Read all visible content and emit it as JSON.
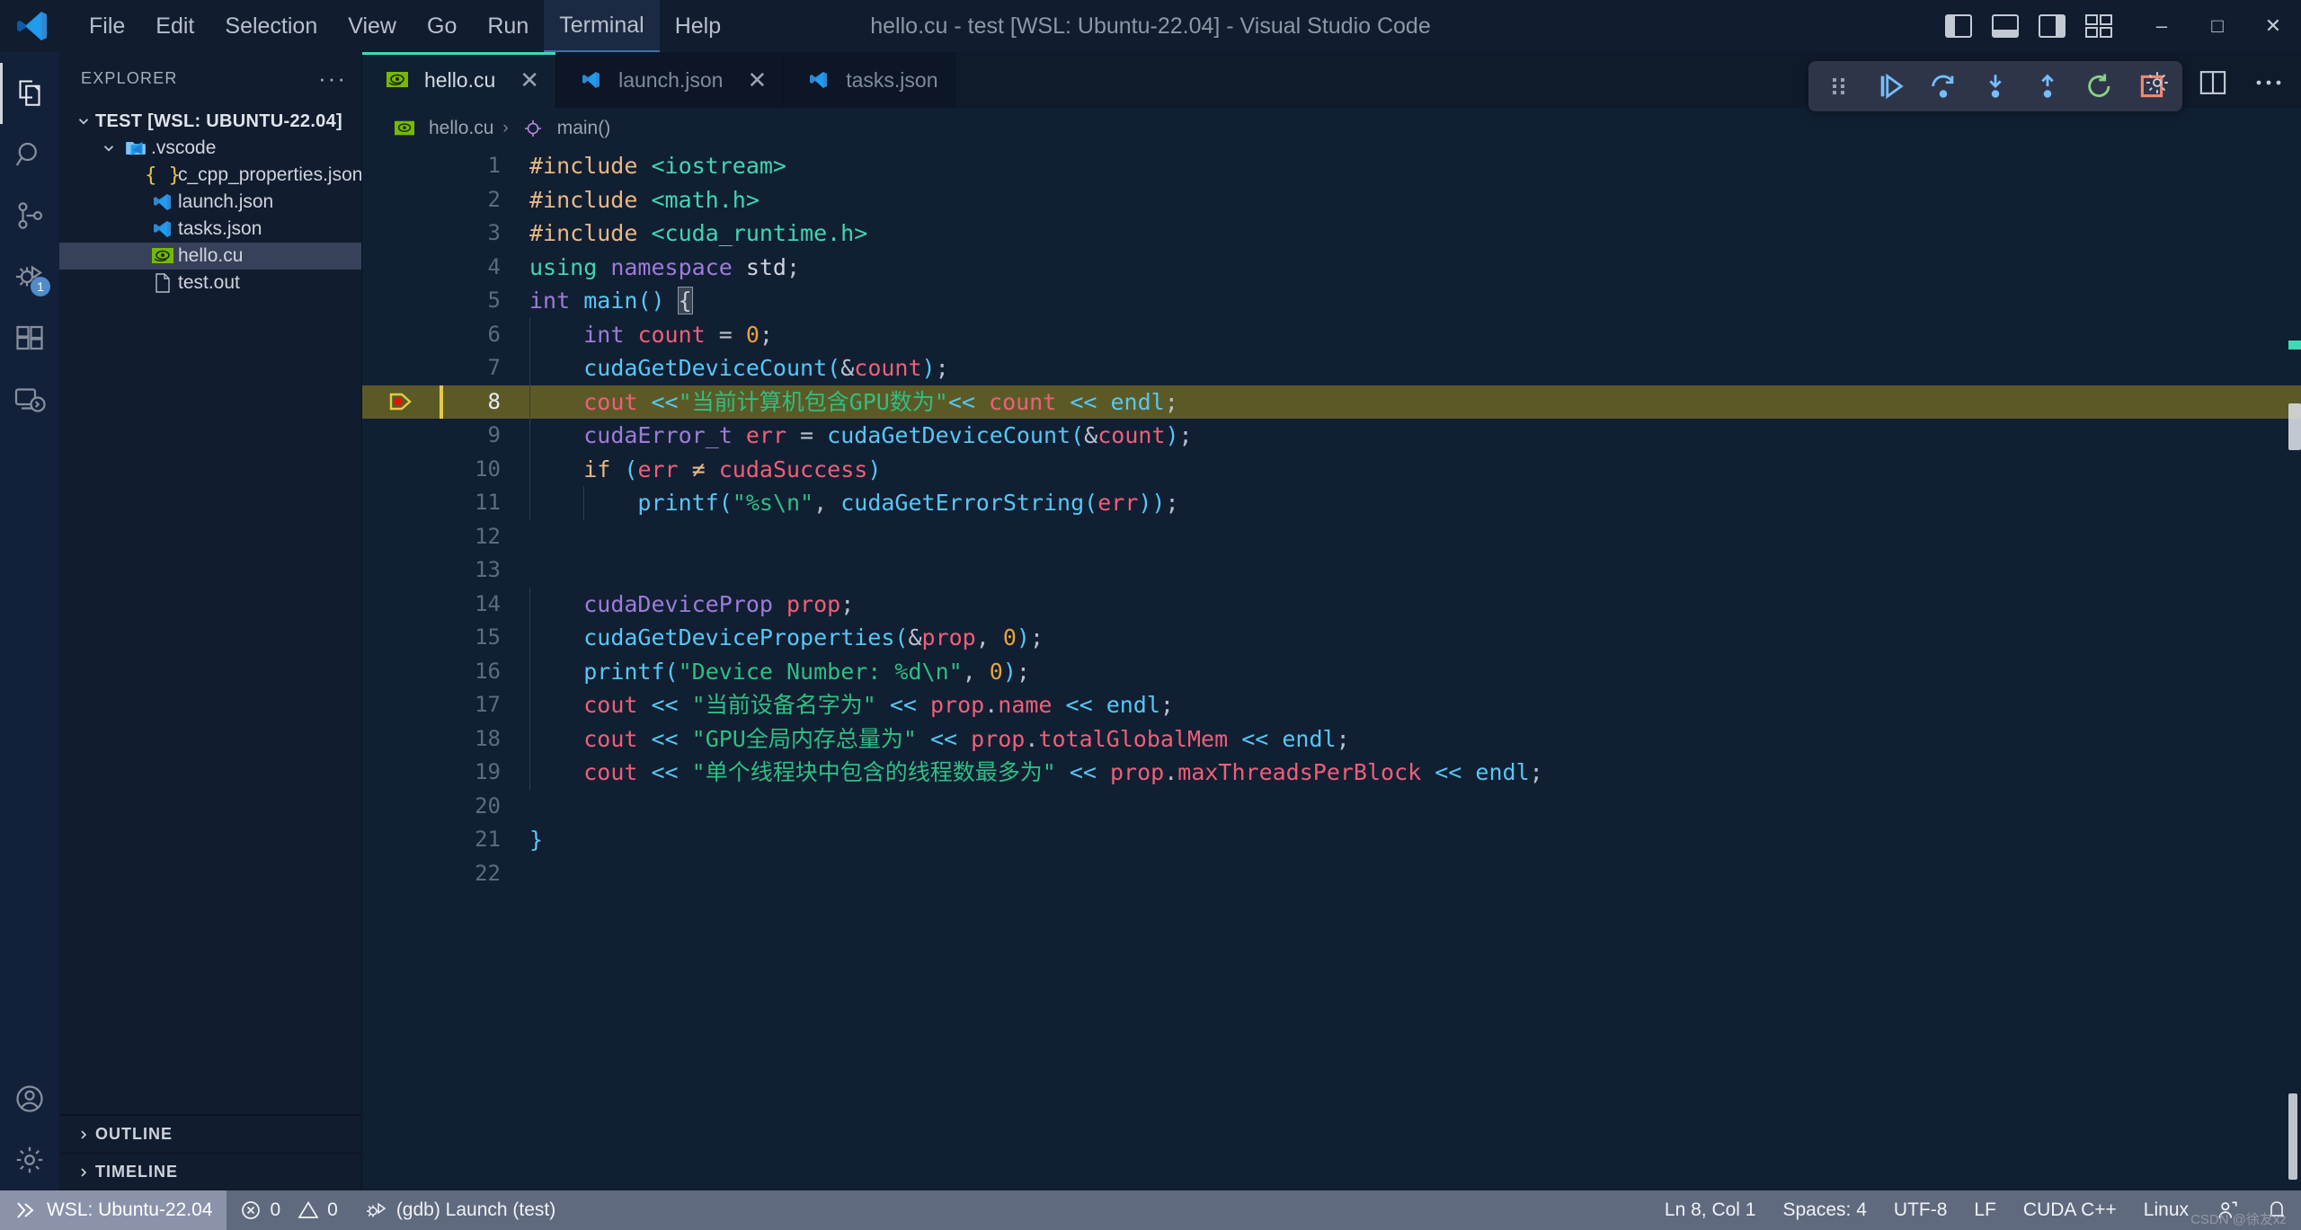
{
  "window": {
    "title": "hello.cu - test [WSL: Ubuntu-22.04] - Visual Studio Code",
    "minimize_label": "–",
    "maximize_label": "□",
    "close_label": "✕"
  },
  "menu": {
    "items": [
      {
        "label": "File"
      },
      {
        "label": "Edit"
      },
      {
        "label": "Selection"
      },
      {
        "label": "View"
      },
      {
        "label": "Go"
      },
      {
        "label": "Run"
      },
      {
        "label": "Terminal"
      },
      {
        "label": "Help"
      }
    ]
  },
  "activitybar": {
    "items": [
      {
        "name": "explorer",
        "icon": "files-icon",
        "active": true,
        "badge": ""
      },
      {
        "name": "search",
        "icon": "search-icon",
        "active": false,
        "badge": ""
      },
      {
        "name": "source-control",
        "icon": "source-control-icon",
        "active": false,
        "badge": ""
      },
      {
        "name": "run-and-debug",
        "icon": "debug-icon",
        "active": false,
        "badge": "1"
      },
      {
        "name": "extensions",
        "icon": "extensions-icon",
        "active": false,
        "badge": ""
      },
      {
        "name": "remote-explorer",
        "icon": "remote-explorer-icon",
        "active": false,
        "badge": ""
      }
    ],
    "bottom": [
      {
        "name": "accounts",
        "icon": "account-icon"
      },
      {
        "name": "manage",
        "icon": "gear-icon"
      }
    ]
  },
  "sidebar": {
    "header": "EXPLORER",
    "more_actions": "···",
    "root": {
      "label": "TEST [WSL: UBUNTU-22.04]",
      "expanded": true
    },
    "tree": [
      {
        "label": ".vscode",
        "icon": "vscode-folder-icon",
        "depth": 1,
        "expanded": true,
        "selected": false
      },
      {
        "label": "c_cpp_properties.json",
        "icon": "json-braces-icon",
        "depth": 2,
        "selected": false
      },
      {
        "label": "launch.json",
        "icon": "vscode-file-icon",
        "depth": 2,
        "selected": false
      },
      {
        "label": "tasks.json",
        "icon": "vscode-file-icon",
        "depth": 2,
        "selected": false
      },
      {
        "label": "hello.cu",
        "icon": "nvidia-cuda-icon",
        "depth": 1,
        "selected": true
      },
      {
        "label": "test.out",
        "icon": "plain-file-icon",
        "depth": 1,
        "selected": false
      }
    ],
    "sections": [
      {
        "label": "OUTLINE"
      },
      {
        "label": "TIMELINE"
      }
    ]
  },
  "tabs": [
    {
      "label": "hello.cu",
      "icon": "nvidia-cuda-icon",
      "active": true,
      "close": "✕"
    },
    {
      "label": "launch.json",
      "icon": "vscode-file-icon",
      "active": false,
      "close": "✕"
    },
    {
      "label": "tasks.json",
      "icon": "vscode-file-icon",
      "active": false,
      "close": ""
    }
  ],
  "breadcrumb": {
    "file": "hello.cu",
    "separator": "›",
    "symbol": "main()",
    "symbol_icon": "method-icon"
  },
  "debug_toolbar": {
    "buttons": [
      {
        "name": "drag-handle",
        "icon": "grip-dots-icon"
      },
      {
        "name": "continue",
        "icon": "continue-icon"
      },
      {
        "name": "step-over",
        "icon": "step-over-icon"
      },
      {
        "name": "step-into",
        "icon": "step-into-icon"
      },
      {
        "name": "step-out",
        "icon": "step-out-icon"
      },
      {
        "name": "restart",
        "icon": "restart-icon"
      },
      {
        "name": "stop",
        "icon": "stop-icon"
      }
    ]
  },
  "editor_actions": [
    {
      "name": "settings",
      "icon": "gear-icon"
    },
    {
      "name": "split-editor",
      "icon": "split-editor-icon"
    },
    {
      "name": "more-actions",
      "icon": "ellipsis-icon"
    }
  ],
  "editor": {
    "current_line": 8,
    "breakpoint_line": 8,
    "total_lines": 22,
    "lines": [
      {
        "n": 1,
        "tokens": [
          {
            "t": "#include ",
            "c": "t-pre"
          },
          {
            "t": "<iostream>",
            "c": "t-inc"
          }
        ]
      },
      {
        "n": 2,
        "tokens": [
          {
            "t": "#include ",
            "c": "t-pre"
          },
          {
            "t": "<math.h>",
            "c": "t-inc"
          }
        ]
      },
      {
        "n": 3,
        "tokens": [
          {
            "t": "#include ",
            "c": "t-pre"
          },
          {
            "t": "<cuda_runtime.h>",
            "c": "t-inc"
          }
        ]
      },
      {
        "n": 4,
        "tokens": [
          {
            "t": "using ",
            "c": "t-kw"
          },
          {
            "t": "namespace ",
            "c": "t-kw2"
          },
          {
            "t": "std",
            "c": "t-id"
          },
          {
            "t": ";",
            "c": "t-pun"
          }
        ]
      },
      {
        "n": 5,
        "tokens": [
          {
            "t": "int ",
            "c": "t-type"
          },
          {
            "t": "main",
            "c": "t-fn"
          },
          {
            "t": "() ",
            "c": "t-brace"
          },
          {
            "t": "{",
            "c": "cursor-box"
          }
        ]
      },
      {
        "n": 6,
        "tokens": [
          {
            "t": "    ",
            "c": "t-pun"
          },
          {
            "t": "int ",
            "c": "t-type"
          },
          {
            "t": "count",
            "c": "t-var"
          },
          {
            "t": " = ",
            "c": "t-pun"
          },
          {
            "t": "0",
            "c": "t-num"
          },
          {
            "t": ";",
            "c": "t-pun"
          }
        ]
      },
      {
        "n": 7,
        "tokens": [
          {
            "t": "    ",
            "c": "t-pun"
          },
          {
            "t": "cudaGetDeviceCount",
            "c": "t-fn"
          },
          {
            "t": "(",
            "c": "t-brace"
          },
          {
            "t": "&",
            "c": "t-pun"
          },
          {
            "t": "count",
            "c": "t-var"
          },
          {
            "t": ")",
            "c": "t-brace"
          },
          {
            "t": ";",
            "c": "t-pun"
          }
        ]
      },
      {
        "n": 8,
        "tokens": [
          {
            "t": "    ",
            "c": "t-pun"
          },
          {
            "t": "cout",
            "c": "t-var"
          },
          {
            "t": " <<",
            "c": "t-op"
          },
          {
            "t": "\"当前计算机包含GPU数为\"",
            "c": "t-str"
          },
          {
            "t": "<< ",
            "c": "t-op"
          },
          {
            "t": "count",
            "c": "t-var"
          },
          {
            "t": " << ",
            "c": "t-op"
          },
          {
            "t": "endl",
            "c": "t-fn"
          },
          {
            "t": ";",
            "c": "t-pun"
          }
        ]
      },
      {
        "n": 9,
        "tokens": [
          {
            "t": "    ",
            "c": "t-pun"
          },
          {
            "t": "cudaError_t ",
            "c": "t-type"
          },
          {
            "t": "err",
            "c": "t-var"
          },
          {
            "t": " = ",
            "c": "t-pun"
          },
          {
            "t": "cudaGetDeviceCount",
            "c": "t-fn"
          },
          {
            "t": "(",
            "c": "t-brace"
          },
          {
            "t": "&",
            "c": "t-pun"
          },
          {
            "t": "count",
            "c": "t-var"
          },
          {
            "t": ")",
            "c": "t-brace"
          },
          {
            "t": ";",
            "c": "t-pun"
          }
        ]
      },
      {
        "n": 10,
        "tokens": [
          {
            "t": "    ",
            "c": "t-pun"
          },
          {
            "t": "if",
            "c": "t-pre"
          },
          {
            "t": " (",
            "c": "t-brace"
          },
          {
            "t": "err",
            "c": "t-var"
          },
          {
            "t": " ≠ ",
            "c": "t-pre"
          },
          {
            "t": "cudaSuccess",
            "c": "t-var"
          },
          {
            "t": ")",
            "c": "t-brace"
          }
        ]
      },
      {
        "n": 11,
        "tokens": [
          {
            "t": "        ",
            "c": "t-pun"
          },
          {
            "t": "printf",
            "c": "t-fn"
          },
          {
            "t": "(",
            "c": "t-brace"
          },
          {
            "t": "\"%s\\n\"",
            "c": "t-str"
          },
          {
            "t": ", ",
            "c": "t-pun"
          },
          {
            "t": "cudaGetErrorString",
            "c": "t-fn"
          },
          {
            "t": "(",
            "c": "t-brace"
          },
          {
            "t": "err",
            "c": "t-var"
          },
          {
            "t": "))",
            "c": "t-brace"
          },
          {
            "t": ";",
            "c": "t-pun"
          }
        ]
      },
      {
        "n": 12,
        "tokens": []
      },
      {
        "n": 13,
        "tokens": []
      },
      {
        "n": 14,
        "tokens": [
          {
            "t": "    ",
            "c": "t-pun"
          },
          {
            "t": "cudaDeviceProp ",
            "c": "t-type"
          },
          {
            "t": "prop",
            "c": "t-var"
          },
          {
            "t": ";",
            "c": "t-pun"
          }
        ]
      },
      {
        "n": 15,
        "tokens": [
          {
            "t": "    ",
            "c": "t-pun"
          },
          {
            "t": "cudaGetDeviceProperties",
            "c": "t-fn"
          },
          {
            "t": "(",
            "c": "t-brace"
          },
          {
            "t": "&",
            "c": "t-pun"
          },
          {
            "t": "prop",
            "c": "t-var"
          },
          {
            "t": ", ",
            "c": "t-pun"
          },
          {
            "t": "0",
            "c": "t-num"
          },
          {
            "t": ")",
            "c": "t-brace"
          },
          {
            "t": ";",
            "c": "t-pun"
          }
        ]
      },
      {
        "n": 16,
        "tokens": [
          {
            "t": "    ",
            "c": "t-pun"
          },
          {
            "t": "printf",
            "c": "t-fn"
          },
          {
            "t": "(",
            "c": "t-brace"
          },
          {
            "t": "\"Device Number: %d\\n\"",
            "c": "t-str"
          },
          {
            "t": ", ",
            "c": "t-pun"
          },
          {
            "t": "0",
            "c": "t-num"
          },
          {
            "t": ")",
            "c": "t-brace"
          },
          {
            "t": ";",
            "c": "t-pun"
          }
        ]
      },
      {
        "n": 17,
        "tokens": [
          {
            "t": "    ",
            "c": "t-pun"
          },
          {
            "t": "cout",
            "c": "t-var"
          },
          {
            "t": " << ",
            "c": "t-op"
          },
          {
            "t": "\"当前设备名字为\"",
            "c": "t-str"
          },
          {
            "t": " << ",
            "c": "t-op"
          },
          {
            "t": "prop",
            "c": "t-var"
          },
          {
            "t": ".",
            "c": "t-pun"
          },
          {
            "t": "name",
            "c": "t-var"
          },
          {
            "t": " << ",
            "c": "t-op"
          },
          {
            "t": "endl",
            "c": "t-fn"
          },
          {
            "t": ";",
            "c": "t-pun"
          }
        ]
      },
      {
        "n": 18,
        "tokens": [
          {
            "t": "    ",
            "c": "t-pun"
          },
          {
            "t": "cout",
            "c": "t-var"
          },
          {
            "t": " << ",
            "c": "t-op"
          },
          {
            "t": "\"GPU全局内存总量为\"",
            "c": "t-str"
          },
          {
            "t": " << ",
            "c": "t-op"
          },
          {
            "t": "prop",
            "c": "t-var"
          },
          {
            "t": ".",
            "c": "t-pun"
          },
          {
            "t": "totalGlobalMem",
            "c": "t-var"
          },
          {
            "t": " << ",
            "c": "t-op"
          },
          {
            "t": "endl",
            "c": "t-fn"
          },
          {
            "t": ";",
            "c": "t-pun"
          }
        ]
      },
      {
        "n": 19,
        "tokens": [
          {
            "t": "    ",
            "c": "t-pun"
          },
          {
            "t": "cout",
            "c": "t-var"
          },
          {
            "t": " << ",
            "c": "t-op"
          },
          {
            "t": "\"单个线程块中包含的线程数最多为\"",
            "c": "t-str"
          },
          {
            "t": " << ",
            "c": "t-op"
          },
          {
            "t": "prop",
            "c": "t-var"
          },
          {
            "t": ".",
            "c": "t-pun"
          },
          {
            "t": "maxThreadsPerBlock",
            "c": "t-var"
          },
          {
            "t": " << ",
            "c": "t-op"
          },
          {
            "t": "endl",
            "c": "t-fn"
          },
          {
            "t": ";",
            "c": "t-pun"
          }
        ]
      },
      {
        "n": 20,
        "tokens": []
      },
      {
        "n": 21,
        "tokens": [
          {
            "t": "}",
            "c": "t-brace"
          }
        ]
      },
      {
        "n": 22,
        "tokens": []
      }
    ]
  },
  "statusbar": {
    "remote": "WSL: Ubuntu-22.04",
    "errors": "0",
    "warnings": "0",
    "debug_session": "(gdb) Launch (test)",
    "cursor": "Ln 8, Col 1",
    "indentation": "Spaces: 4",
    "encoding": "UTF-8",
    "eol": "LF",
    "language": "CUDA C++",
    "platform": "Linux",
    "watermark": "CSDN @徐友xz"
  },
  "colors": {
    "titlebar_bg": "#111c2e",
    "activitybar_bg": "#13203a",
    "sidebar_bg": "#111c2e",
    "editor_bg": "#111f33",
    "statusbar_bg": "#5f6a7e",
    "remote_bg": "#8b93ab",
    "tab_active_border": "#3ddbb0",
    "current_line_bg": "#5b5a26",
    "current_line_border": "#e5c84a",
    "selection_bg": "#37415a",
    "nvidia_green": "#76b900",
    "vscode_blue": "#2f88d0",
    "breakpoint_red": "#e51400",
    "debug_blue": "#75beff",
    "restart_green": "#89d185",
    "stop_red": "#f48771"
  }
}
